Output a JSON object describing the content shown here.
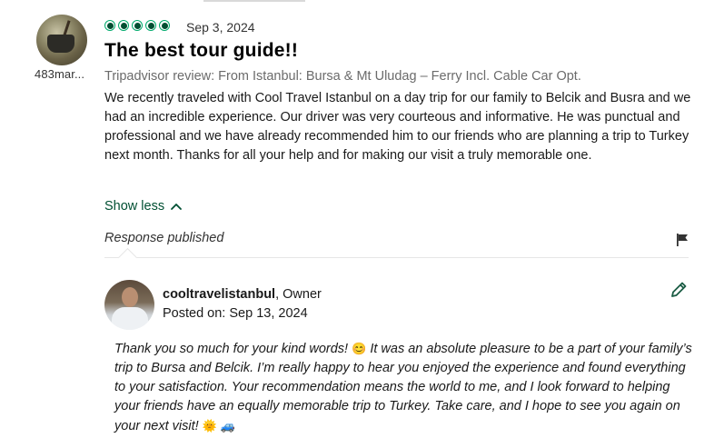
{
  "review": {
    "reviewer_name": "483mar...",
    "rating": 5,
    "date": "Sep 3, 2024",
    "title": "The best tour guide!!",
    "source": "Tripadvisor review: From Istanbul: Bursa & Mt Uludag – Ferry Incl. Cable Car Opt.",
    "body": "We recently traveled with Cool Travel Istanbul on a day trip for our family to Belcik and Busra and we had an incredible experience. Our driver was very courteous and informative. He was punctual and professional and we have already recommended him to our friends who are planning a trip to Turkey next month. Thanks for all your help and for making our visit a truly memorable one.",
    "show_less_label": "Show less"
  },
  "response": {
    "status_label": "Response published",
    "owner_name": "cooltravelistanbul",
    "owner_role": ", Owner",
    "posted_on_label": "Posted on:",
    "posted_on_date": "Sep 13, 2024",
    "body_part1": "Thank you so much for your kind words! ",
    "emoji1": "😊",
    "body_part2": " It was an absolute pleasure to be a part of your family’s trip to Bursa and Belcik. I’m really happy to hear you enjoyed the experience and found everything to your satisfaction. Your recommendation means the world to me, and I look forward to helping your friends have an equally memorable trip to Turkey. Take care, and I hope to see you again on your next visit! ",
    "emoji2": "🌞",
    "emoji3": "🚙"
  },
  "colors": {
    "bubble_fill": "#004f32",
    "bubble_outline": "#00aa6c",
    "link": "#004f32"
  },
  "icons": {
    "rating": "bubble-rating-icon",
    "show_less": "chevron-up-icon",
    "flag": "flag-icon",
    "edit": "pencil-icon"
  }
}
